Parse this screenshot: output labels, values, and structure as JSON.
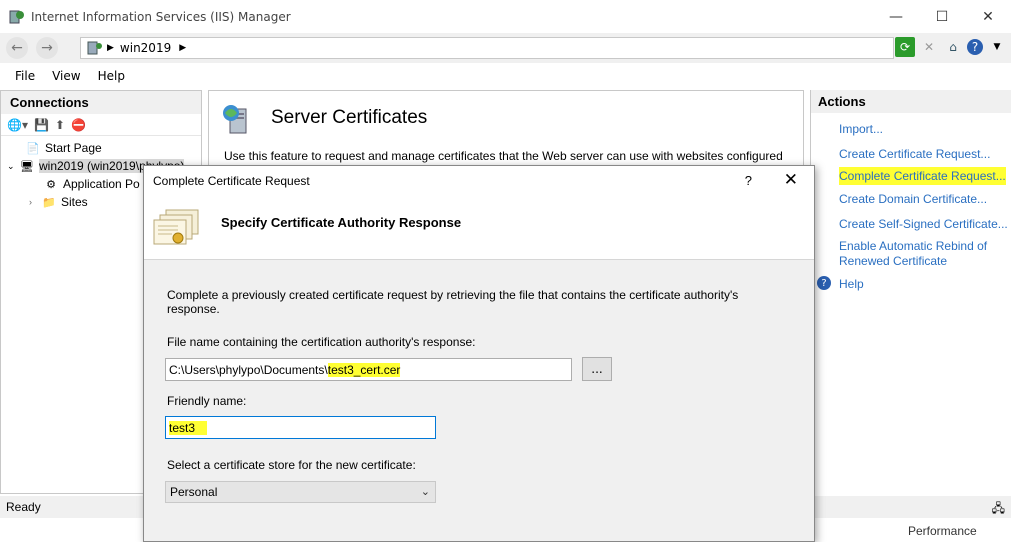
{
  "window": {
    "title": "Internet Information Services (IIS) Manager",
    "controls": [
      "—",
      "☐",
      "✕"
    ]
  },
  "addressbar": {
    "path": "win2019",
    "back_icon": "back-arrow-icon",
    "forward_icon": "forward-arrow-icon"
  },
  "menu": {
    "file": "File",
    "view": "View",
    "help": "Help"
  },
  "connections": {
    "header": "Connections",
    "tree": [
      {
        "label": "Start Page"
      },
      {
        "label": "win2019 (win2019\\phylypo)"
      },
      {
        "label": "Application Po"
      },
      {
        "label": "Sites"
      }
    ]
  },
  "center": {
    "title": "Server Certificates",
    "description": "Use this feature to request and manage certificates that the Web server can use with websites configured"
  },
  "actions": {
    "header": "Actions",
    "items": [
      {
        "label": "Import..."
      },
      {
        "label": "Create Certificate Request..."
      },
      {
        "label": "Complete Certificate Request..."
      },
      {
        "label": "Create Domain Certificate..."
      },
      {
        "label": "Create Self-Signed Certificate..."
      },
      {
        "label": "Enable Automatic Rebind of"
      },
      {
        "label": "Renewed Certificate"
      },
      {
        "label": "Help"
      }
    ]
  },
  "status": {
    "text": "Ready",
    "performance": "Performance"
  },
  "dialog": {
    "title": "Complete Certificate Request",
    "help": "?",
    "close": "✕",
    "heading": "Specify Certificate Authority Response",
    "intro_line1": "Complete a previously created certificate request by retrieving the file that contains the certificate authority's",
    "intro_line2": "response.",
    "file_label": "File name containing the certification authority's response:",
    "file_prefix": "C:\\Users\\phylypo\\Documents\\",
    "file_name": "test3_cert.cer",
    "browse_label": "...",
    "friendly_label": "Friendly name:",
    "friendly_value": "test3",
    "store_label": "Select a certificate store for the new certificate:",
    "store_value": "Personal"
  },
  "colors": {
    "link": "#2a6fc1",
    "highlight": "#ffff33",
    "focus_border": "#0078d7"
  }
}
